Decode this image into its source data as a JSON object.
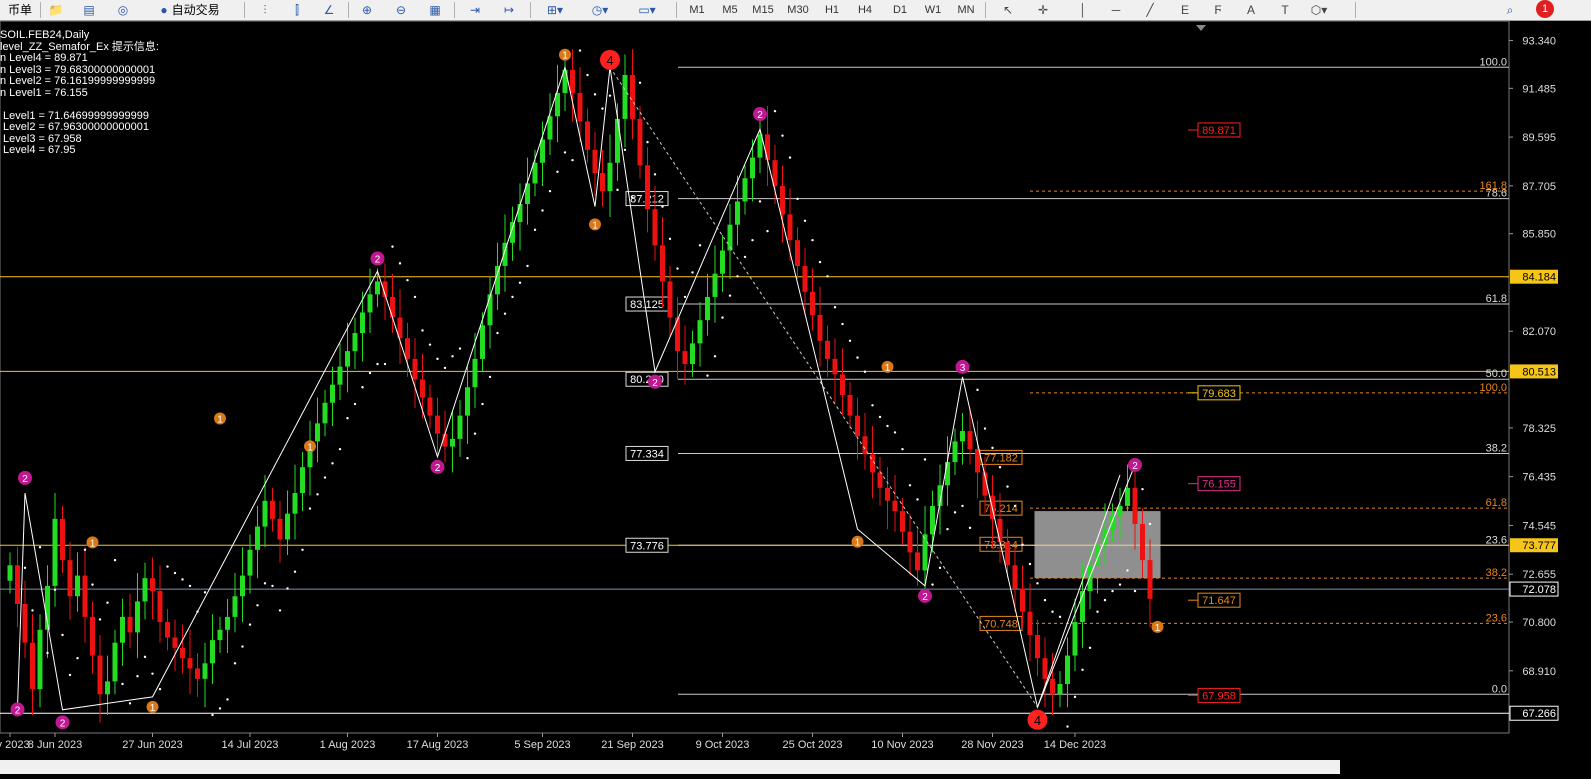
{
  "toolbar": {
    "items": [
      {
        "label": "币单",
        "x": 0,
        "w": 36
      },
      {
        "icon": "folder-icon",
        "x": 45,
        "w": 22
      },
      {
        "icon": "terminal-icon",
        "x": 78,
        "w": 22
      },
      {
        "icon": "globe-icon",
        "x": 112,
        "w": 22
      },
      {
        "icon": "autotrade-icon",
        "label": "自动交易",
        "x": 145,
        "w": 90
      },
      {
        "icon": "bar-chart-icon",
        "x": 254,
        "w": 22
      },
      {
        "icon": "candle-chart-icon",
        "x": 286,
        "w": 22
      },
      {
        "icon": "line-chart-icon",
        "x": 318,
        "w": 22
      },
      {
        "icon": "zoom-in-icon",
        "x": 356,
        "w": 22
      },
      {
        "icon": "zoom-out-icon",
        "x": 390,
        "w": 22
      },
      {
        "icon": "tile-icon",
        "x": 424,
        "w": 22
      },
      {
        "icon": "autoscroll-icon",
        "x": 464,
        "w": 22
      },
      {
        "icon": "chart-shift-icon",
        "x": 498,
        "w": 22
      },
      {
        "icon": "add-indicator-icon",
        "x": 538,
        "w": 34
      },
      {
        "icon": "period-clock-icon",
        "x": 583,
        "w": 34
      },
      {
        "icon": "template-icon",
        "x": 626,
        "w": 42
      }
    ],
    "timeframes": [
      "M1",
      "M5",
      "M15",
      "M30",
      "H1",
      "H4",
      "D1",
      "W1",
      "MN"
    ],
    "tools": [
      "cursor",
      "crosshair",
      "vline",
      "hline",
      "trendline",
      "fib-icon",
      "fib-fan-icon",
      "text-A",
      "text-T",
      "shapes-icon"
    ],
    "alert_count": "1"
  },
  "indicator_info": {
    "lines": [
      "SOIL.FEB24,Daily",
      "level_ZZ_Semafor_Ex 提示信息:",
      "n Level4 = 89.871",
      "n Level3 = 79.68300000000001",
      "n Level2 = 76.16199999999999",
      "n Level1 = 76.155",
      "",
      " Level1 = 71.64699999999999",
      " Level2 = 67.96300000000001",
      " Level3 = 67.958",
      " Level4 = 67.95"
    ]
  },
  "colors": {
    "bull": "#22dd22",
    "bear": "#ee1111",
    "zigzag": "#ffffff",
    "fib": "#c8c8c8",
    "gold": "#f5c518",
    "orange_label": "#e8861c",
    "semafor_2": "#c01890",
    "semafor_1": "#d87818",
    "semafor_4": "#ff2020"
  },
  "chart_data": {
    "type": "candlestick",
    "symbol": "SOIL.FEB24",
    "timeframe": "Daily",
    "ylim": [
      66.5,
      93.9
    ],
    "y_ticks": [
      93.34,
      91.485,
      89.595,
      87.705,
      85.85,
      84.184,
      82.07,
      80.513,
      78.325,
      76.435,
      74.545,
      73.777,
      72.655,
      72.078,
      70.8,
      68.91,
      67.266
    ],
    "x_ticks": [
      {
        "i": 0,
        "label": "ay 2023"
      },
      {
        "i": 6,
        "label": "8 Jun 2023"
      },
      {
        "i": 19,
        "label": "27 Jun 2023"
      },
      {
        "i": 32,
        "label": "14 Jul 2023"
      },
      {
        "i": 45,
        "label": "1 Aug 2023"
      },
      {
        "i": 57,
        "label": "17 Aug 2023"
      },
      {
        "i": 71,
        "label": "5 Sep 2023"
      },
      {
        "i": 83,
        "label": "21 Sep 2023"
      },
      {
        "i": 95,
        "label": "9 Oct 2023"
      },
      {
        "i": 107,
        "label": "25 Oct 2023"
      },
      {
        "i": 119,
        "label": "10 Nov 2023"
      },
      {
        "i": 131,
        "label": "28 Nov 2023"
      },
      {
        "i": 142,
        "label": "14 Dec 2023"
      }
    ],
    "closes": [
      73.0,
      71.5,
      70.0,
      68.2,
      70.5,
      72.2,
      74.8,
      73.2,
      71.8,
      72.6,
      71.0,
      69.5,
      68.0,
      68.5,
      70.0,
      71.0,
      70.4,
      71.6,
      72.5,
      72.0,
      70.8,
      70.2,
      69.8,
      69.4,
      69.0,
      68.6,
      69.2,
      70.1,
      70.5,
      71.0,
      71.8,
      72.6,
      73.6,
      74.5,
      75.5,
      74.8,
      74.0,
      75.0,
      75.8,
      76.8,
      77.8,
      78.5,
      79.3,
      80.0,
      80.7,
      81.3,
      82.0,
      82.8,
      83.5,
      84.0,
      83.4,
      82.6,
      81.8,
      81.0,
      80.2,
      79.5,
      78.8,
      78.1,
      77.6,
      77.9,
      78.8,
      79.9,
      81.0,
      82.3,
      83.5,
      84.6,
      85.5,
      86.3,
      87.0,
      87.8,
      88.6,
      89.5,
      90.4,
      91.3,
      92.2,
      91.3,
      90.2,
      89.1,
      88.2,
      87.5,
      88.6,
      90.3,
      92.0,
      90.3,
      88.5,
      86.8,
      85.4,
      84.0,
      82.6,
      81.3,
      80.8,
      81.6,
      82.5,
      83.4,
      84.3,
      85.2,
      86.2,
      87.1,
      88.0,
      88.8,
      89.7,
      88.7,
      87.7,
      86.6,
      85.6,
      84.6,
      83.6,
      82.7,
      81.7,
      81.0,
      80.4,
      79.6,
      78.8,
      78.0,
      77.3,
      76.6,
      76.0,
      75.5,
      75.1,
      74.3,
      73.5,
      72.8,
      74.2,
      75.3,
      76.1,
      77.0,
      77.8,
      78.2,
      77.5,
      76.6,
      75.7,
      74.8,
      73.9,
      73.0,
      72.1,
      71.2,
      70.3,
      69.4,
      68.6,
      68.0,
      68.4,
      69.5,
      70.8,
      72.0,
      73.0,
      73.8,
      74.4,
      74.9,
      75.3,
      76.0,
      74.6,
      73.2,
      71.7
    ],
    "semafor": [
      {
        "i": 1,
        "price": 67.8,
        "level": 2,
        "pos": "below"
      },
      {
        "i": 2,
        "price": 76.0,
        "level": 2,
        "pos": "above"
      },
      {
        "i": 7,
        "price": 67.3,
        "level": 2,
        "pos": "below"
      },
      {
        "i": 11,
        "price": 73.5,
        "level": 1,
        "pos": "above"
      },
      {
        "i": 19,
        "price": 67.9,
        "level": 1,
        "pos": "below"
      },
      {
        "i": 28,
        "price": 78.3,
        "level": 1,
        "pos": "above"
      },
      {
        "i": 40,
        "price": 78.0,
        "level": 1,
        "pos": "below"
      },
      {
        "i": 49,
        "price": 84.5,
        "level": 2,
        "pos": "above"
      },
      {
        "i": 57,
        "price": 77.2,
        "level": 2,
        "pos": "below"
      },
      {
        "i": 74,
        "price": 92.4,
        "level": 1,
        "pos": "above"
      },
      {
        "i": 78,
        "price": 86.6,
        "level": 1,
        "pos": "below"
      },
      {
        "i": 80,
        "price": 92.2,
        "level": 4,
        "pos": "above"
      },
      {
        "i": 86,
        "price": 80.5,
        "level": 2,
        "pos": "below"
      },
      {
        "i": 100,
        "price": 90.1,
        "level": 2,
        "pos": "above"
      },
      {
        "i": 113,
        "price": 74.3,
        "level": 1,
        "pos": "below"
      },
      {
        "i": 117,
        "price": 80.3,
        "level": 1,
        "pos": "above"
      },
      {
        "i": 122,
        "price": 72.2,
        "level": 2,
        "pos": "below"
      },
      {
        "i": 127,
        "price": 80.3,
        "level": 3,
        "pos": "above"
      },
      {
        "i": 137,
        "price": 67.4,
        "level": 4,
        "pos": "below"
      },
      {
        "i": 150,
        "price": 76.5,
        "level": 2,
        "pos": "above"
      },
      {
        "i": 153,
        "price": 71.0,
        "level": 1,
        "pos": "below"
      }
    ],
    "zigzag_points": [
      [
        1,
        67.5
      ],
      [
        2,
        75.8
      ],
      [
        7,
        67.4
      ],
      [
        19,
        67.9
      ],
      [
        49,
        84.4
      ],
      [
        57,
        77.2
      ],
      [
        74,
        92.3
      ],
      [
        78,
        86.9
      ],
      [
        80,
        92.3
      ],
      [
        86,
        80.5
      ],
      [
        100,
        89.9
      ],
      [
        113,
        74.4
      ],
      [
        122,
        72.2
      ],
      [
        127,
        80.3
      ],
      [
        137,
        67.5
      ],
      [
        148,
        76.5
      ]
    ],
    "horizontal_lines": [
      {
        "price": 84.184,
        "color": "#f5c518",
        "label": "84.184",
        "tag_bg": "#f5c518",
        "tag_fg": "#000"
      },
      {
        "price": 80.513,
        "color": "#f5c518",
        "label": "80.513",
        "tag_bg": "#f5c518",
        "tag_fg": "#000"
      },
      {
        "price": 73.777,
        "color": "#f5c518",
        "label": "73.777",
        "tag_bg": "#f5c518",
        "tag_fg": "#000"
      },
      {
        "price": 72.078,
        "color": "#8090a8",
        "label": "72.078",
        "tag_bg": "#000",
        "tag_fg": "#fff"
      },
      {
        "price": 67.266,
        "color": "#ffffff",
        "label": "67.266",
        "tag_bg": "#000",
        "tag_fg": "#fff"
      }
    ],
    "fib_primary": [
      {
        "price": 92.3,
        "label": "100.0"
      },
      {
        "price": 87.212,
        "label": "78.6"
      },
      {
        "price": 83.125,
        "label": "61.8"
      },
      {
        "price": 80.21,
        "label": "50.0"
      },
      {
        "price": 77.334,
        "label": "38.2"
      },
      {
        "price": 73.776,
        "label": "23.6"
      },
      {
        "price": 68.0,
        "label": "0.0"
      }
    ],
    "fib_price_boxes": [
      "87.212",
      "83.125",
      "80.210",
      "77.334",
      "73.776"
    ],
    "fib_secondary": [
      {
        "price": 87.5,
        "label": "161.8"
      },
      {
        "price": 79.683,
        "label": "100.0"
      },
      {
        "price": 75.214,
        "label": "61.8"
      },
      {
        "price": 72.5,
        "label": "38.2"
      },
      {
        "price": 70.748,
        "label": "23.6"
      }
    ],
    "fib_secondary_boxes": [
      "77.182",
      "75.214",
      "73.814",
      "70.748"
    ],
    "level_tags": [
      {
        "price": 89.871,
        "label": "89.871",
        "color": "#ff2020"
      },
      {
        "price": 79.683,
        "label": "79.683",
        "color": "#f5c518"
      },
      {
        "price": 76.162,
        "label": "76.155",
        "color": "#e0308a"
      },
      {
        "price": 71.647,
        "label": "71.647",
        "color": "#e8861c"
      },
      {
        "price": 67.958,
        "label": "67.958",
        "color": "#ff2020"
      }
    ],
    "grey_box": {
      "i0": 137,
      "i1": 153,
      "top": 75.1,
      "bottom": 72.5
    }
  }
}
